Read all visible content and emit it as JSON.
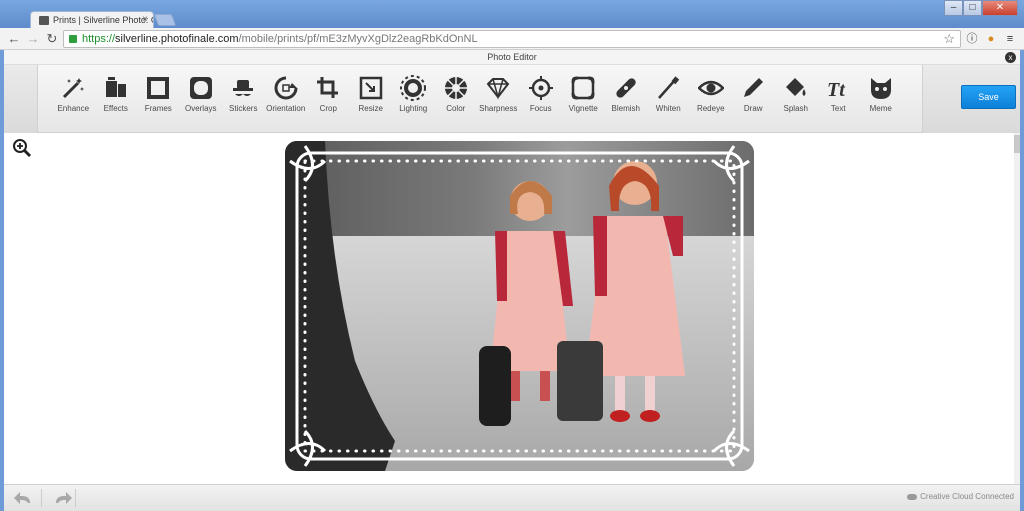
{
  "browser": {
    "tab_title": "Prints | Silverline Photo: C",
    "url_scheme": "https://",
    "url_host": "silverline.photofinale.com",
    "url_path": "/mobile/prints/pf/mE3zMyvXgDlz2eagRbKdOnNL",
    "window_buttons": {
      "minimize": "–",
      "maximize": "□",
      "close": "✕"
    }
  },
  "editor": {
    "title": "Photo Editor",
    "close_symbol": "x",
    "save_label": "Save",
    "tools": [
      {
        "label": "Enhance",
        "icon": "magic-wand-icon"
      },
      {
        "label": "Effects",
        "icon": "effects-icon"
      },
      {
        "label": "Frames",
        "icon": "frames-icon"
      },
      {
        "label": "Overlays",
        "icon": "overlays-icon"
      },
      {
        "label": "Stickers",
        "icon": "stickers-icon"
      },
      {
        "label": "Orientation",
        "icon": "orientation-icon"
      },
      {
        "label": "Crop",
        "icon": "crop-icon"
      },
      {
        "label": "Resize",
        "icon": "resize-icon"
      },
      {
        "label": "Lighting",
        "icon": "lighting-icon"
      },
      {
        "label": "Color",
        "icon": "color-icon"
      },
      {
        "label": "Sharpness",
        "icon": "sharpness-icon"
      },
      {
        "label": "Focus",
        "icon": "focus-icon"
      },
      {
        "label": "Vignette",
        "icon": "vignette-icon"
      },
      {
        "label": "Blemish",
        "icon": "blemish-icon"
      },
      {
        "label": "Whiten",
        "icon": "whiten-icon"
      },
      {
        "label": "Redeye",
        "icon": "redeye-icon"
      },
      {
        "label": "Draw",
        "icon": "draw-icon"
      },
      {
        "label": "Splash",
        "icon": "splash-icon"
      },
      {
        "label": "Text",
        "icon": "text-icon"
      },
      {
        "label": "Meme",
        "icon": "meme-icon"
      }
    ],
    "footer_status": "Creative Cloud Connected",
    "accent_color": "#1592e6"
  }
}
